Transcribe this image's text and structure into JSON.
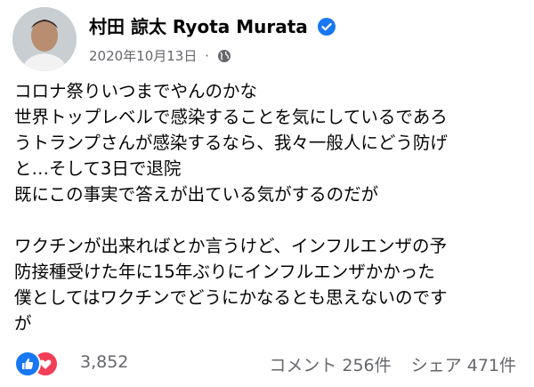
{
  "author": {
    "name": "村田 諒太 Ryota Murata",
    "verified": true
  },
  "post_meta": {
    "date": "2020年10月13日",
    "separator": "·",
    "audience_icon": "globe-icon"
  },
  "body": {
    "lines": [
      "コロナ祭りいつまでやんのかな",
      "世界トップレベルで感染することを気にしているであろ",
      "うトランプさんが感染するなら、我々一般人にどう防げ",
      "と…そして3日で退院",
      "既にこの事実で答えが出ている気がするのだが",
      "",
      "ワクチンが出来ればとか言うけど、インフルエンザの予",
      "防接種受けた年に15年ぶりにインフルエンザかかった",
      "僕としてはワクチンでどうにかなるとも思えないのです",
      "が"
    ]
  },
  "footer": {
    "reaction_icons": [
      "like-icon",
      "love-icon"
    ],
    "reaction_count": "3,852",
    "comments": "コメント 256件",
    "shares": "シェア 471件"
  },
  "colors": {
    "like": "#1877f2",
    "love": "#f33e58",
    "verified": "#1877f2",
    "muted": "#65676b"
  }
}
